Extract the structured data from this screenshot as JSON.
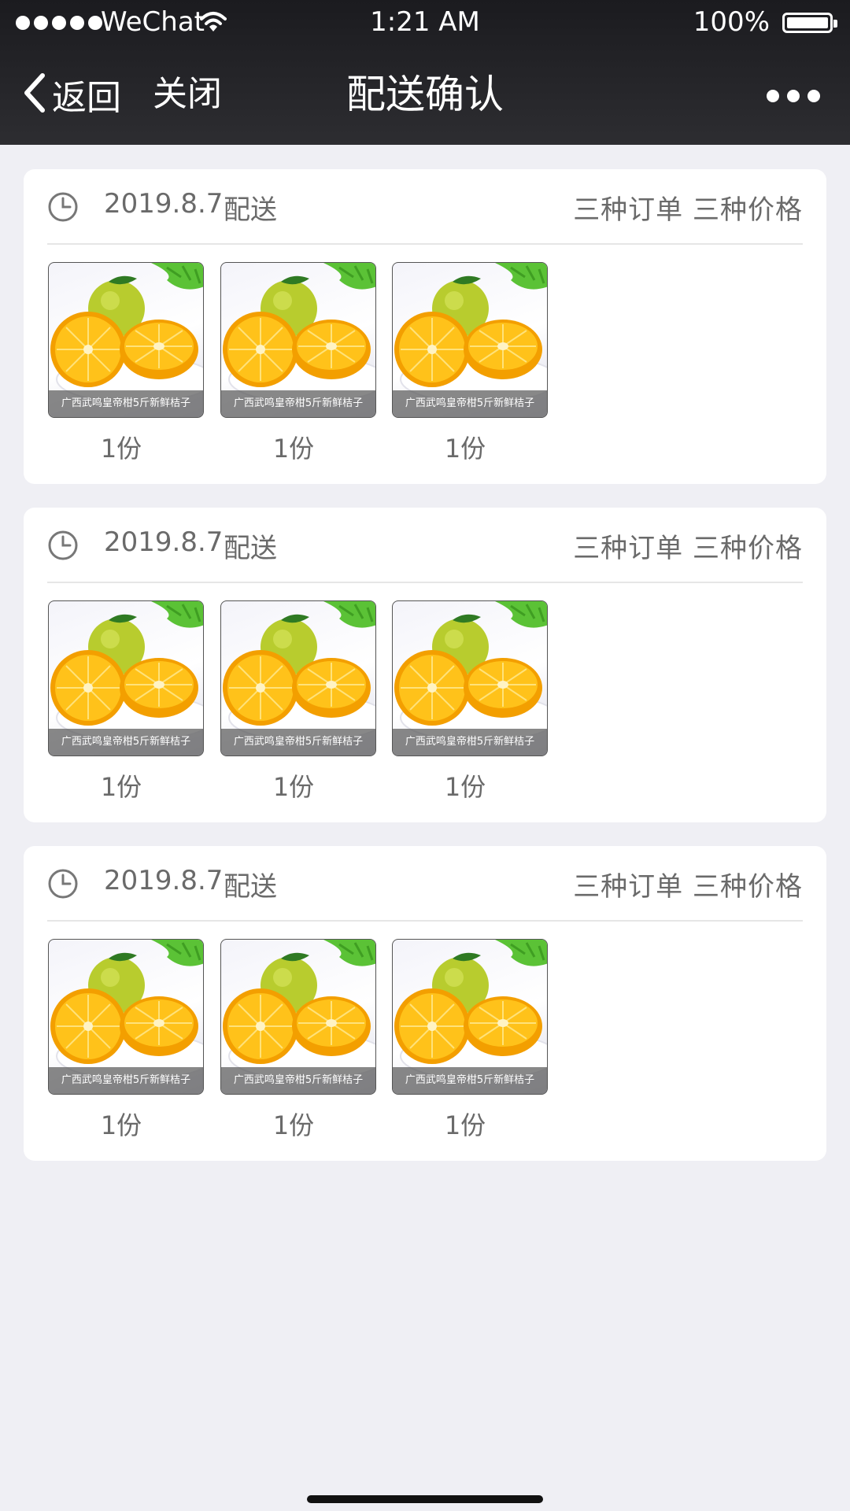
{
  "status_bar": {
    "carrier": "WeChat",
    "time": "1:21 AM",
    "battery": "100%"
  },
  "nav": {
    "back_label": "返回",
    "close_label": "关闭",
    "title": "配送确认"
  },
  "orders": [
    {
      "date": "2019.8.7",
      "delivery_label": "配送",
      "types_label": "三种订单 三种价格",
      "products": [
        {
          "caption": "广西武鸣皇帝柑5斤新鲜桔子",
          "qty": "1份"
        },
        {
          "caption": "广西武鸣皇帝柑5斤新鲜桔子",
          "qty": "1份"
        },
        {
          "caption": "广西武鸣皇帝柑5斤新鲜桔子",
          "qty": "1份"
        }
      ]
    },
    {
      "date": "2019.8.7",
      "delivery_label": "配送",
      "types_label": "三种订单 三种价格",
      "products": [
        {
          "caption": "广西武鸣皇帝柑5斤新鲜桔子",
          "qty": "1份"
        },
        {
          "caption": "广西武鸣皇帝柑5斤新鲜桔子",
          "qty": "1份"
        },
        {
          "caption": "广西武鸣皇帝柑5斤新鲜桔子",
          "qty": "1份"
        }
      ]
    },
    {
      "date": "2019.8.7",
      "delivery_label": "配送",
      "types_label": "三种订单 三种价格",
      "products": [
        {
          "caption": "广西武鸣皇帝柑5斤新鲜桔子",
          "qty": "1份"
        },
        {
          "caption": "广西武鸣皇帝柑5斤新鲜桔子",
          "qty": "1份"
        },
        {
          "caption": "广西武鸣皇帝柑5斤新鲜桔子",
          "qty": "1份"
        }
      ]
    }
  ],
  "icons": {
    "back": "chevron-left-icon",
    "more": "more-dots-icon",
    "clock": "clock-icon",
    "wifi": "wifi-icon",
    "battery": "battery-icon"
  },
  "colors": {
    "nav_background": "#1b1b1f",
    "page_background": "#efeff4",
    "card_background": "#ffffff",
    "secondary_text": "#6a6a6a",
    "orange": "#f6b400",
    "lime": "#b8cc2e"
  }
}
